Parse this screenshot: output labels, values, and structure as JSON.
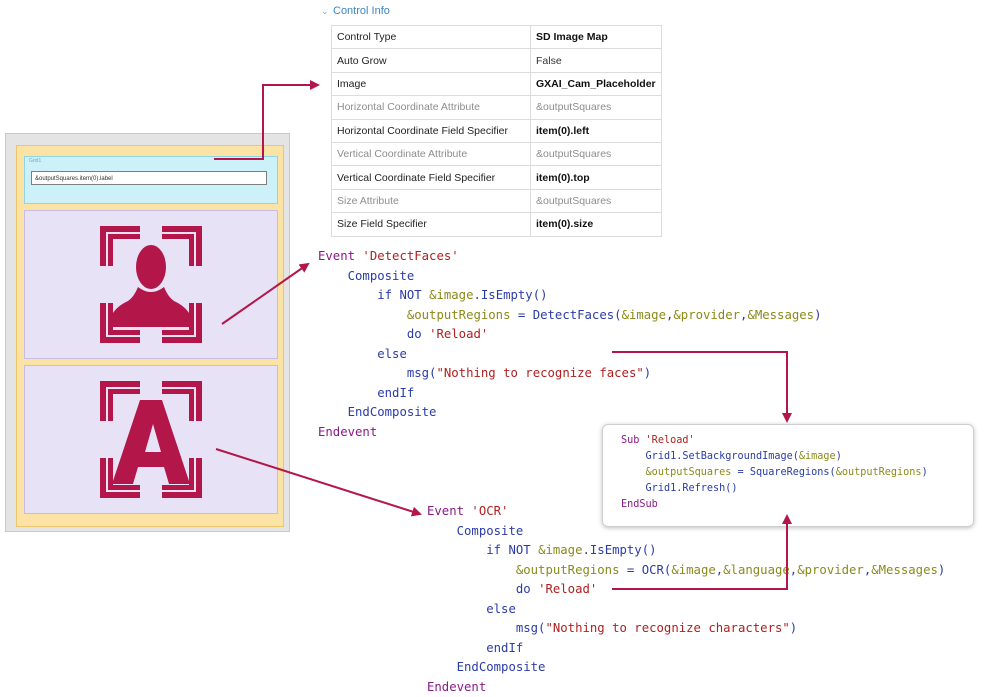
{
  "control_info": {
    "title": "Control Info",
    "rows": [
      {
        "prop": "Control Type",
        "value": "SD Image Map",
        "style": "bold"
      },
      {
        "prop": "Auto Grow",
        "value": "False",
        "style": "normal"
      },
      {
        "prop": "Image",
        "value": "GXAI_Cam_Placeholder",
        "style": "bold"
      },
      {
        "prop": "Horizontal Coordinate Attribute",
        "value": "&outputSquares",
        "style": "dim"
      },
      {
        "prop": "Horizontal Coordinate Field Specifier",
        "value": "item(0).left",
        "style": "bold"
      },
      {
        "prop": "Vertical Coordinate Attribute",
        "value": "&outputSquares",
        "style": "dim"
      },
      {
        "prop": "Vertical Coordinate Field Specifier",
        "value": "item(0).top",
        "style": "bold"
      },
      {
        "prop": "Size Attribute",
        "value": "&outputSquares",
        "style": "dim"
      },
      {
        "prop": "Size Field Specifier",
        "value": "item(0).size",
        "style": "bold"
      }
    ]
  },
  "form": {
    "grid_label": "Grid1",
    "grid_field": "&outputSquares.item(0).label",
    "face_icon": "face-recognition-icon",
    "ocr_icon": "ocr-letter-a-icon",
    "accent_color": "#b3174a"
  },
  "code": {
    "detect": [
      [
        [
          "kw",
          "Event "
        ],
        [
          "str",
          "'DetectFaces'"
        ]
      ],
      [
        [
          "plain",
          "    "
        ],
        [
          "blu",
          "Composite"
        ]
      ],
      [
        [
          "plain",
          "        "
        ],
        [
          "blu",
          "if NOT "
        ],
        [
          "var",
          "&image"
        ],
        [
          "blu",
          ".IsEmpty()"
        ]
      ],
      [
        [
          "plain",
          "            "
        ],
        [
          "var",
          "&outputRegions"
        ],
        [
          "blu",
          " = DetectFaces("
        ],
        [
          "var",
          "&image"
        ],
        [
          "blu",
          ","
        ],
        [
          "var",
          "&provider"
        ],
        [
          "blu",
          ","
        ],
        [
          "var",
          "&Messages"
        ],
        [
          "blu",
          ")"
        ]
      ],
      [
        [
          "plain",
          "            "
        ],
        [
          "blu",
          "do "
        ],
        [
          "str",
          "'Reload'"
        ]
      ],
      [
        [
          "plain",
          "        "
        ],
        [
          "blu",
          "else"
        ]
      ],
      [
        [
          "plain",
          "            "
        ],
        [
          "blu",
          "msg("
        ],
        [
          "str",
          "\"Nothing to recognize faces\""
        ],
        [
          "blu",
          ")"
        ]
      ],
      [
        [
          "plain",
          "        "
        ],
        [
          "blu",
          "endIf"
        ]
      ],
      [
        [
          "plain",
          "    "
        ],
        [
          "blu",
          "EndComposite"
        ]
      ],
      [
        [
          "kw",
          "Endevent"
        ]
      ]
    ],
    "reload": [
      [
        [
          "kw",
          "Sub "
        ],
        [
          "str",
          "'Reload'"
        ]
      ],
      [
        [
          "plain",
          "    "
        ],
        [
          "blu",
          "Grid1.SetBackgroundImage("
        ],
        [
          "var",
          "&image"
        ],
        [
          "blu",
          ")"
        ]
      ],
      [
        [
          "plain",
          "    "
        ],
        [
          "var",
          "&outputSquares"
        ],
        [
          "blu",
          " = SquareRegions("
        ],
        [
          "var",
          "&outputRegions"
        ],
        [
          "blu",
          ")"
        ]
      ],
      [
        [
          "plain",
          "    "
        ],
        [
          "blu",
          "Grid1.Refresh()"
        ]
      ],
      [
        [
          "kw",
          "EndSub"
        ]
      ]
    ],
    "ocr": [
      [
        [
          "kw",
          "Event "
        ],
        [
          "str",
          "'OCR'"
        ]
      ],
      [
        [
          "plain",
          "    "
        ],
        [
          "blu",
          "Composite"
        ]
      ],
      [
        [
          "plain",
          "        "
        ],
        [
          "blu",
          "if NOT "
        ],
        [
          "var",
          "&image"
        ],
        [
          "blu",
          ".IsEmpty()"
        ]
      ],
      [
        [
          "plain",
          "            "
        ],
        [
          "var",
          "&outputRegions"
        ],
        [
          "blu",
          " = OCR("
        ],
        [
          "var",
          "&image"
        ],
        [
          "blu",
          ","
        ],
        [
          "var",
          "&language"
        ],
        [
          "blu",
          ","
        ],
        [
          "var",
          "&provider"
        ],
        [
          "blu",
          ","
        ],
        [
          "var",
          "&Messages"
        ],
        [
          "blu",
          ")"
        ]
      ],
      [
        [
          "plain",
          "            "
        ],
        [
          "blu",
          "do "
        ],
        [
          "str",
          "'Reload'"
        ]
      ],
      [
        [
          "plain",
          "        "
        ],
        [
          "blu",
          "else"
        ]
      ],
      [
        [
          "plain",
          "            "
        ],
        [
          "blu",
          "msg("
        ],
        [
          "str",
          "\"Nothing to recognize characters\""
        ],
        [
          "blu",
          ")"
        ]
      ],
      [
        [
          "plain",
          "        "
        ],
        [
          "blu",
          "endIf"
        ]
      ],
      [
        [
          "plain",
          "    "
        ],
        [
          "blu",
          "EndComposite"
        ]
      ],
      [
        [
          "kw",
          "Endevent"
        ]
      ]
    ]
  }
}
